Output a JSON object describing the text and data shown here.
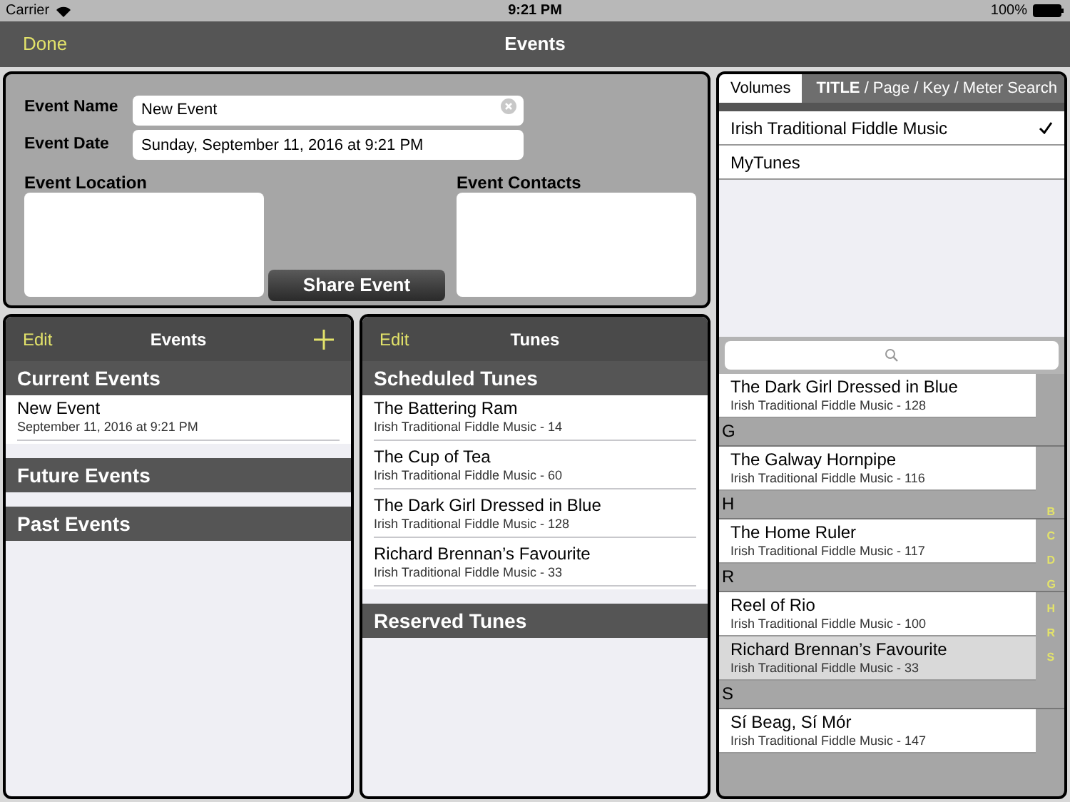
{
  "status_bar": {
    "carrier": "Carrier",
    "time": "9:21 PM",
    "battery": "100%"
  },
  "nav_bar": {
    "left_button": "Done",
    "title": "Events"
  },
  "event_form": {
    "name_label": "Event Name",
    "name_value": "New Event",
    "date_label": "Event Date",
    "date_value": "Sunday, September 11, 2016 at 9:21 PM",
    "location_label": "Event Location",
    "contacts_label": "Event Contacts",
    "share_button": "Share Event"
  },
  "events_panel": {
    "edit": "Edit",
    "title": "Events",
    "sections": [
      {
        "header": "Current Events",
        "items": [
          {
            "title": "New Event",
            "subtitle": "September 11, 2016 at 9:21 PM"
          }
        ]
      },
      {
        "header": "Future Events"
      },
      {
        "header": "Past Events"
      }
    ]
  },
  "tunes_panel": {
    "edit": "Edit",
    "title": "Tunes",
    "sections": [
      {
        "header": "Scheduled Tunes",
        "items": [
          {
            "title": "The Battering Ram",
            "subtitle": "Irish Traditional Fiddle Music - 14"
          },
          {
            "title": "The Cup of Tea",
            "subtitle": "Irish Traditional Fiddle Music - 60"
          },
          {
            "title": "The Dark Girl Dressed in Blue",
            "subtitle": "Irish Traditional Fiddle Music - 128"
          },
          {
            "title": "Richard Brennan’s Favourite",
            "subtitle": "Irish Traditional Fiddle Music - 33"
          }
        ]
      },
      {
        "header": "Reserved Tunes"
      }
    ]
  },
  "library_panel": {
    "tabs": [
      {
        "label": "Volumes",
        "selected": true
      },
      {
        "label": "**TITLE** / Page / Key / Meter Search",
        "selected": false
      }
    ],
    "volumes": [
      {
        "label": "Irish Traditional Fiddle Music",
        "checked": true
      },
      {
        "label": "MyTunes",
        "checked": false
      }
    ],
    "sections": [
      {
        "items": [
          {
            "title": "The Dark Girl Dressed in Blue",
            "subtitle": "Irish Traditional Fiddle Music - 128",
            "selected": false
          }
        ]
      },
      {
        "header": "G",
        "items": [
          {
            "title": "The Galway Hornpipe",
            "subtitle": "Irish Traditional Fiddle Music - 116",
            "selected": false
          }
        ]
      },
      {
        "header": "H",
        "items": [
          {
            "title": "The Home Ruler",
            "subtitle": "Irish Traditional Fiddle Music - 117",
            "selected": false
          }
        ]
      },
      {
        "header": "R",
        "items": [
          {
            "title": "Reel of Rio",
            "subtitle": "Irish Traditional Fiddle Music - 100",
            "selected": false
          },
          {
            "title": "Richard Brennan’s Favourite",
            "subtitle": "Irish Traditional Fiddle Music - 33",
            "selected": true
          }
        ]
      },
      {
        "header": "S",
        "items": [
          {
            "title": "Sí Beag, Sí Mór",
            "subtitle": "Irish Traditional Fiddle Music - 147",
            "selected": false
          }
        ]
      }
    ],
    "index": [
      "B",
      "C",
      "D",
      "G",
      "H",
      "R",
      "S"
    ]
  }
}
